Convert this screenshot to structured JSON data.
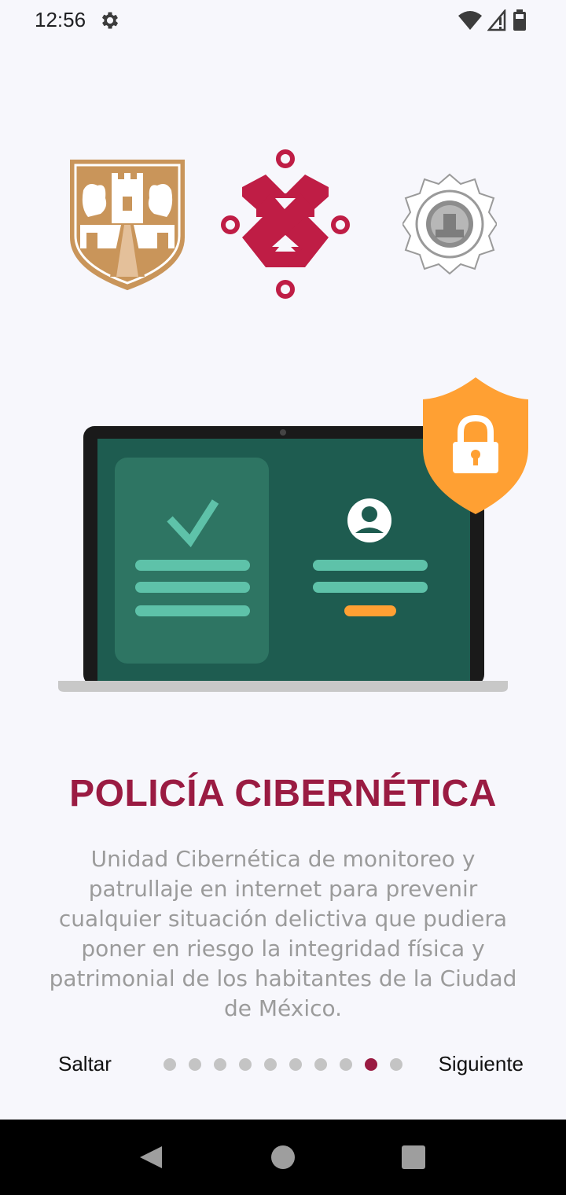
{
  "status_bar": {
    "time": "12:56",
    "icons": [
      "settings-gear-icon",
      "wifi-icon",
      "cellular-signal-icon",
      "battery-icon"
    ]
  },
  "logos": [
    "cdmx-shield-logo",
    "cdmx-cross-emblem-logo",
    "seguridad-ciudadana-badge-logo"
  ],
  "illustration": {
    "description_icons": [
      "laptop-icon",
      "checkmark-icon",
      "user-avatar-icon",
      "padlock-shield-icon"
    ]
  },
  "onboarding": {
    "title": "POLICÍA CIBERNÉTICA",
    "description": "Unidad Cibernética de monitoreo y patrullaje en internet para prevenir cualquier situación delictiva que pudiera poner en riesgo la integridad física y patrimonial de los habitantes de la Ciudad de México.",
    "skip_label": "Saltar",
    "next_label": "Siguiente",
    "page_count": 10,
    "current_page": 9
  },
  "colors": {
    "accent": "#9a1b42",
    "background": "#f7f7fc",
    "shield_gold": "#c9955a",
    "screen_green": "#1e5c50",
    "lock_orange": "#ffa033",
    "dot_inactive": "#c4c4c4"
  },
  "system_nav": {
    "icons": [
      "back-icon",
      "home-icon",
      "recents-icon"
    ]
  }
}
